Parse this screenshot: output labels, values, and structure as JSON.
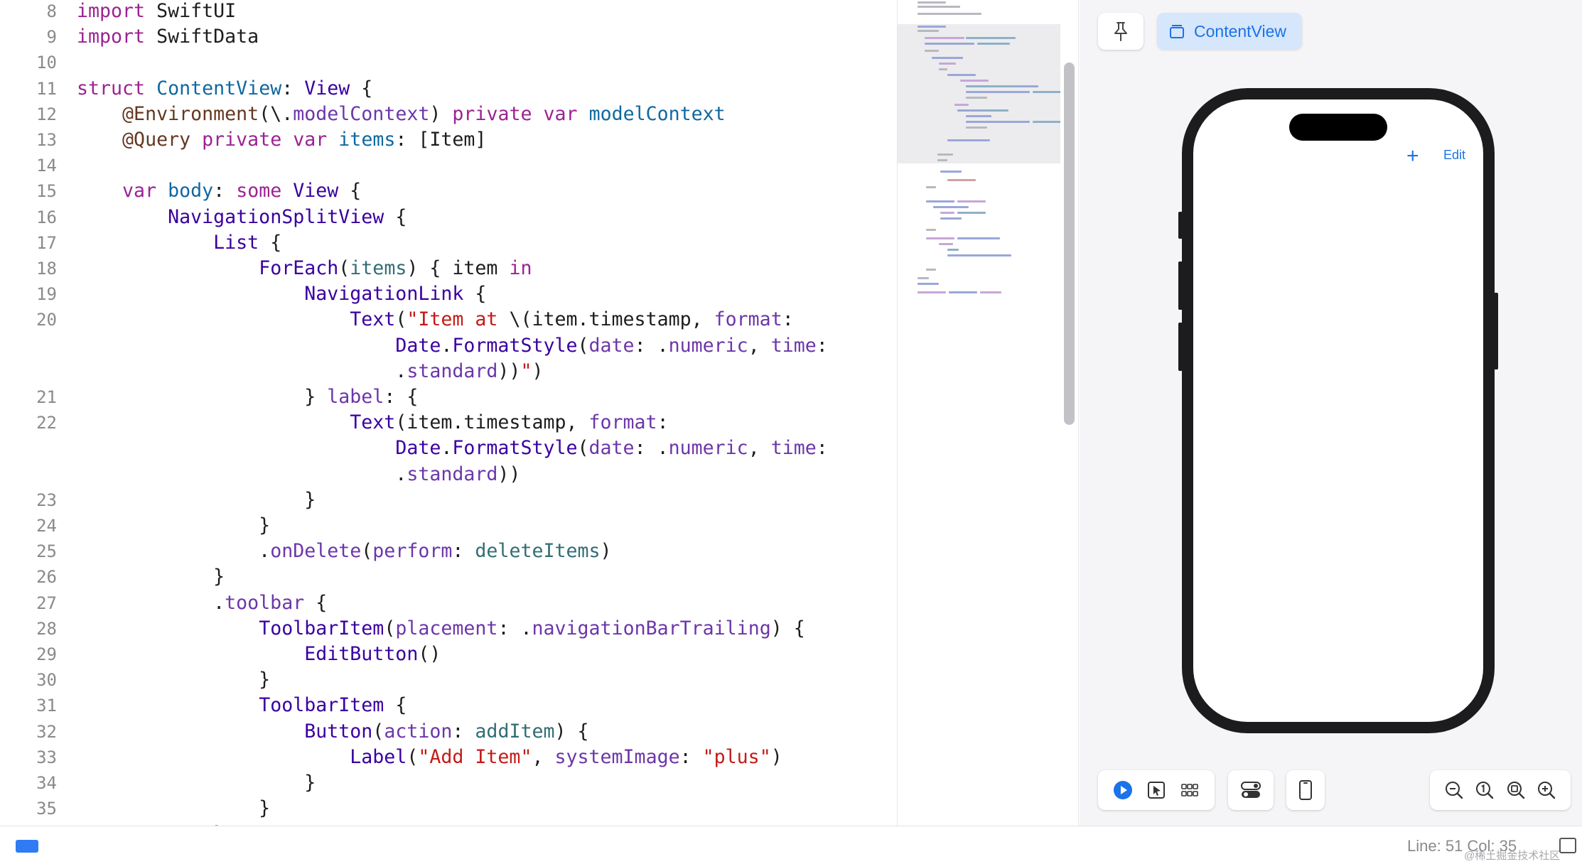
{
  "editor": {
    "lines": [
      {
        "num": "8",
        "segments": [
          {
            "t": "import",
            "c": "kw"
          },
          {
            "t": " SwiftUI",
            "c": "plain"
          }
        ]
      },
      {
        "num": "9",
        "segments": [
          {
            "t": "import",
            "c": "kw"
          },
          {
            "t": " SwiftData",
            "c": "plain"
          }
        ]
      },
      {
        "num": "10",
        "segments": []
      },
      {
        "num": "11",
        "segments": [
          {
            "t": "struct",
            "c": "kw"
          },
          {
            "t": " ",
            "c": "plain"
          },
          {
            "t": "ContentView",
            "c": "decl"
          },
          {
            "t": ": ",
            "c": "plain"
          },
          {
            "t": "View",
            "c": "type"
          },
          {
            "t": " {",
            "c": "plain"
          }
        ]
      },
      {
        "num": "12",
        "segments": [
          {
            "t": "    ",
            "c": "plain"
          },
          {
            "t": "@Environment",
            "c": "attr"
          },
          {
            "t": "(\\.",
            "c": "plain"
          },
          {
            "t": "modelContext",
            "c": "prop"
          },
          {
            "t": ") ",
            "c": "plain"
          },
          {
            "t": "private",
            "c": "kw"
          },
          {
            "t": " ",
            "c": "plain"
          },
          {
            "t": "var",
            "c": "kw"
          },
          {
            "t": " ",
            "c": "plain"
          },
          {
            "t": "modelContext",
            "c": "decl"
          }
        ]
      },
      {
        "num": "13",
        "segments": [
          {
            "t": "    ",
            "c": "plain"
          },
          {
            "t": "@Query",
            "c": "attr"
          },
          {
            "t": " ",
            "c": "plain"
          },
          {
            "t": "private",
            "c": "kw"
          },
          {
            "t": " ",
            "c": "plain"
          },
          {
            "t": "var",
            "c": "kw"
          },
          {
            "t": " ",
            "c": "plain"
          },
          {
            "t": "items",
            "c": "decl"
          },
          {
            "t": ": [Item]",
            "c": "plain"
          }
        ]
      },
      {
        "num": "14",
        "segments": []
      },
      {
        "num": "15",
        "segments": [
          {
            "t": "    ",
            "c": "plain"
          },
          {
            "t": "var",
            "c": "kw"
          },
          {
            "t": " ",
            "c": "plain"
          },
          {
            "t": "body",
            "c": "decl"
          },
          {
            "t": ": ",
            "c": "plain"
          },
          {
            "t": "some",
            "c": "kw"
          },
          {
            "t": " ",
            "c": "plain"
          },
          {
            "t": "View",
            "c": "type"
          },
          {
            "t": " {",
            "c": "plain"
          }
        ]
      },
      {
        "num": "16",
        "segments": [
          {
            "t": "        ",
            "c": "plain"
          },
          {
            "t": "NavigationSplitView",
            "c": "type"
          },
          {
            "t": " {",
            "c": "plain"
          }
        ]
      },
      {
        "num": "17",
        "segments": [
          {
            "t": "            ",
            "c": "plain"
          },
          {
            "t": "List",
            "c": "type"
          },
          {
            "t": " {",
            "c": "plain"
          }
        ]
      },
      {
        "num": "18",
        "segments": [
          {
            "t": "                ",
            "c": "plain"
          },
          {
            "t": "ForEach",
            "c": "type"
          },
          {
            "t": "(",
            "c": "plain"
          },
          {
            "t": "items",
            "c": "var"
          },
          {
            "t": ") { item ",
            "c": "plain"
          },
          {
            "t": "in",
            "c": "kw"
          }
        ]
      },
      {
        "num": "19",
        "segments": [
          {
            "t": "                    ",
            "c": "plain"
          },
          {
            "t": "NavigationLink",
            "c": "type"
          },
          {
            "t": " {",
            "c": "plain"
          }
        ]
      },
      {
        "num": "20",
        "segments": [
          {
            "t": "                        ",
            "c": "plain"
          },
          {
            "t": "Text",
            "c": "type"
          },
          {
            "t": "(",
            "c": "plain"
          },
          {
            "t": "\"Item at ",
            "c": "str"
          },
          {
            "t": "\\(item.timestamp, ",
            "c": "plain"
          },
          {
            "t": "format",
            "c": "prop"
          },
          {
            "t": ":",
            "c": "plain"
          }
        ]
      },
      {
        "num": "",
        "segments": [
          {
            "t": "                            ",
            "c": "plain"
          },
          {
            "t": "Date",
            "c": "type"
          },
          {
            "t": ".",
            "c": "plain"
          },
          {
            "t": "FormatStyle",
            "c": "type"
          },
          {
            "t": "(",
            "c": "plain"
          },
          {
            "t": "date",
            "c": "prop"
          },
          {
            "t": ": .",
            "c": "plain"
          },
          {
            "t": "numeric",
            "c": "prop"
          },
          {
            "t": ", ",
            "c": "plain"
          },
          {
            "t": "time",
            "c": "prop"
          },
          {
            "t": ":",
            "c": "plain"
          }
        ]
      },
      {
        "num": "",
        "segments": [
          {
            "t": "                            .",
            "c": "plain"
          },
          {
            "t": "standard",
            "c": "prop"
          },
          {
            "t": "))",
            "c": "plain"
          },
          {
            "t": "\"",
            "c": "str"
          },
          {
            "t": ")",
            "c": "plain"
          }
        ]
      },
      {
        "num": "21",
        "segments": [
          {
            "t": "                    } ",
            "c": "plain"
          },
          {
            "t": "label",
            "c": "prop"
          },
          {
            "t": ": {",
            "c": "plain"
          }
        ]
      },
      {
        "num": "22",
        "segments": [
          {
            "t": "                        ",
            "c": "plain"
          },
          {
            "t": "Text",
            "c": "type"
          },
          {
            "t": "(item.timestamp, ",
            "c": "plain"
          },
          {
            "t": "format",
            "c": "prop"
          },
          {
            "t": ":",
            "c": "plain"
          }
        ]
      },
      {
        "num": "",
        "segments": [
          {
            "t": "                            ",
            "c": "plain"
          },
          {
            "t": "Date",
            "c": "type"
          },
          {
            "t": ".",
            "c": "plain"
          },
          {
            "t": "FormatStyle",
            "c": "type"
          },
          {
            "t": "(",
            "c": "plain"
          },
          {
            "t": "date",
            "c": "prop"
          },
          {
            "t": ": .",
            "c": "plain"
          },
          {
            "t": "numeric",
            "c": "prop"
          },
          {
            "t": ", ",
            "c": "plain"
          },
          {
            "t": "time",
            "c": "prop"
          },
          {
            "t": ":",
            "c": "plain"
          }
        ]
      },
      {
        "num": "",
        "segments": [
          {
            "t": "                            .",
            "c": "plain"
          },
          {
            "t": "standard",
            "c": "prop"
          },
          {
            "t": "))",
            "c": "plain"
          }
        ]
      },
      {
        "num": "23",
        "segments": [
          {
            "t": "                    }",
            "c": "plain"
          }
        ]
      },
      {
        "num": "24",
        "segments": [
          {
            "t": "                }",
            "c": "plain"
          }
        ]
      },
      {
        "num": "25",
        "segments": [
          {
            "t": "                .",
            "c": "plain"
          },
          {
            "t": "onDelete",
            "c": "prop"
          },
          {
            "t": "(",
            "c": "plain"
          },
          {
            "t": "perform",
            "c": "prop"
          },
          {
            "t": ": ",
            "c": "plain"
          },
          {
            "t": "deleteItems",
            "c": "var"
          },
          {
            "t": ")",
            "c": "plain"
          }
        ]
      },
      {
        "num": "26",
        "segments": [
          {
            "t": "            }",
            "c": "plain"
          }
        ]
      },
      {
        "num": "27",
        "segments": [
          {
            "t": "            .",
            "c": "plain"
          },
          {
            "t": "toolbar",
            "c": "prop"
          },
          {
            "t": " {",
            "c": "plain"
          }
        ]
      },
      {
        "num": "28",
        "segments": [
          {
            "t": "                ",
            "c": "plain"
          },
          {
            "t": "ToolbarItem",
            "c": "type"
          },
          {
            "t": "(",
            "c": "plain"
          },
          {
            "t": "placement",
            "c": "prop"
          },
          {
            "t": ": .",
            "c": "plain"
          },
          {
            "t": "navigationBarTrailing",
            "c": "prop"
          },
          {
            "t": ") {",
            "c": "plain"
          }
        ]
      },
      {
        "num": "29",
        "segments": [
          {
            "t": "                    ",
            "c": "plain"
          },
          {
            "t": "EditButton",
            "c": "type"
          },
          {
            "t": "()",
            "c": "plain"
          }
        ]
      },
      {
        "num": "30",
        "segments": [
          {
            "t": "                }",
            "c": "plain"
          }
        ]
      },
      {
        "num": "31",
        "segments": [
          {
            "t": "                ",
            "c": "plain"
          },
          {
            "t": "ToolbarItem",
            "c": "type"
          },
          {
            "t": " {",
            "c": "plain"
          }
        ]
      },
      {
        "num": "32",
        "segments": [
          {
            "t": "                    ",
            "c": "plain"
          },
          {
            "t": "Button",
            "c": "type"
          },
          {
            "t": "(",
            "c": "plain"
          },
          {
            "t": "action",
            "c": "prop"
          },
          {
            "t": ": ",
            "c": "plain"
          },
          {
            "t": "addItem",
            "c": "var"
          },
          {
            "t": ") {",
            "c": "plain"
          }
        ]
      },
      {
        "num": "33",
        "segments": [
          {
            "t": "                        ",
            "c": "plain"
          },
          {
            "t": "Label",
            "c": "type"
          },
          {
            "t": "(",
            "c": "plain"
          },
          {
            "t": "\"Add Item\"",
            "c": "str"
          },
          {
            "t": ", ",
            "c": "plain"
          },
          {
            "t": "systemImage",
            "c": "prop"
          },
          {
            "t": ": ",
            "c": "plain"
          },
          {
            "t": "\"plus\"",
            "c": "str"
          },
          {
            "t": ")",
            "c": "plain"
          }
        ]
      },
      {
        "num": "34",
        "segments": [
          {
            "t": "                    }",
            "c": "plain"
          }
        ]
      },
      {
        "num": "35",
        "segments": [
          {
            "t": "                }",
            "c": "plain"
          }
        ]
      },
      {
        "num": "",
        "segments": [
          {
            "t": "            }",
            "c": "plain"
          }
        ]
      }
    ]
  },
  "syntax_colors": {
    "kw": "#9b2393",
    "type": "#3900a0",
    "decl": "#0f68a0",
    "attr": "#643820",
    "prop": "#6c36a9",
    "var": "#326d74",
    "str": "#c41a16",
    "plain": "#1d1d1f"
  },
  "preview": {
    "pin_icon": "pin-icon",
    "tab_label": "ContentView",
    "tab_icon": "stack-icon",
    "device": {
      "add_icon": "+",
      "edit_label": "Edit"
    },
    "toolbar_icons": [
      "live-play-icon",
      "select-icon",
      "variants-icon",
      "settings-toggle-icon",
      "device-icon",
      "zoom-out-icon",
      "zoom-actual-icon",
      "zoom-fit-icon",
      "zoom-in-icon"
    ]
  },
  "statusbar": {
    "line_col": "Line: 51  Col: 35",
    "watermark": "@稀土掘金技术社区"
  }
}
